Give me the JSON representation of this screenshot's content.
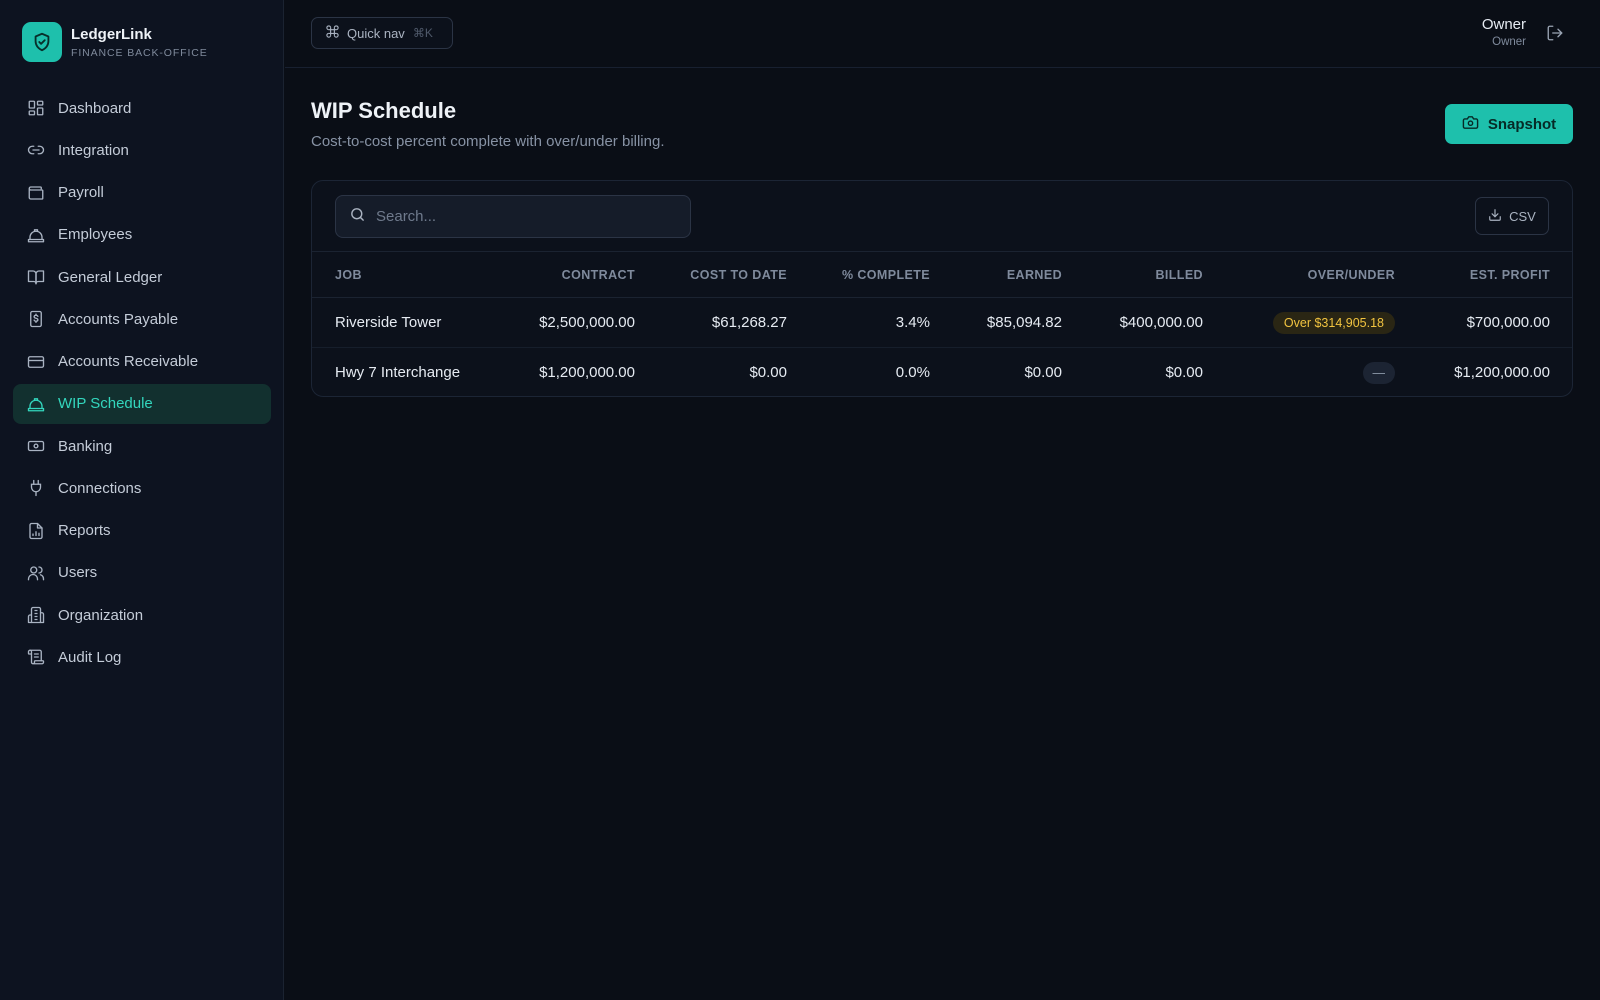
{
  "brand": {
    "name": "LedgerLink",
    "subtitle": "FINANCE BACK-OFFICE",
    "accent": "#1ec0ac"
  },
  "sidebar": {
    "items": [
      {
        "label": "Dashboard",
        "icon": "dashboard-icon",
        "active": false
      },
      {
        "label": "Integration",
        "icon": "link-icon",
        "active": false
      },
      {
        "label": "Payroll",
        "icon": "wallet-icon",
        "active": false
      },
      {
        "label": "Employees",
        "icon": "hard-hat-icon",
        "active": false
      },
      {
        "label": "General Ledger",
        "icon": "book-icon",
        "active": false
      },
      {
        "label": "Accounts Payable",
        "icon": "receipt-dollar-icon",
        "active": false
      },
      {
        "label": "Accounts Receivable",
        "icon": "credit-card-icon",
        "active": false
      },
      {
        "label": "WIP Schedule",
        "icon": "hard-hat-icon",
        "active": true
      },
      {
        "label": "Banking",
        "icon": "banknote-icon",
        "active": false
      },
      {
        "label": "Connections",
        "icon": "plug-icon",
        "active": false
      },
      {
        "label": "Reports",
        "icon": "file-chart-icon",
        "active": false
      },
      {
        "label": "Users",
        "icon": "users-icon",
        "active": false
      },
      {
        "label": "Organization",
        "icon": "building-icon",
        "active": false
      },
      {
        "label": "Audit Log",
        "icon": "scroll-icon",
        "active": false
      }
    ]
  },
  "topbar": {
    "quicknav": {
      "label": "Quick nav",
      "shortcut": "⌘K",
      "icon": "command-icon"
    },
    "user": {
      "name": "Owner",
      "role": "Owner"
    },
    "logout_icon": "logout-icon"
  },
  "page": {
    "title": "WIP Schedule",
    "subtitle": "Cost-to-cost percent complete with over/under billing.",
    "snapshot_label": "Snapshot",
    "snapshot_icon": "camera-icon"
  },
  "table": {
    "search_placeholder": "Search...",
    "csv_label": "CSV",
    "columns": [
      "JOB",
      "CONTRACT",
      "COST TO DATE",
      "% COMPLETE",
      "EARNED",
      "BILLED",
      "OVER/UNDER",
      "EST. PROFIT"
    ],
    "rows": [
      {
        "job": "Riverside Tower",
        "contract": "$2,500,000.00",
        "cost_to_date": "$61,268.27",
        "pct_complete": "3.4%",
        "earned": "$85,094.82",
        "billed": "$400,000.00",
        "over_under": "Over $314,905.18",
        "est_profit": "$700,000.00"
      },
      {
        "job": "Hwy 7 Interchange",
        "contract": "$1,200,000.00",
        "cost_to_date": "$0.00",
        "pct_complete": "0.0%",
        "earned": "$0.00",
        "billed": "$0.00",
        "over_under": "—",
        "est_profit": "$1,200,000.00"
      }
    ]
  },
  "colors": {
    "over_badge": "#f2c440",
    "active_nav": "#33d6bd"
  }
}
